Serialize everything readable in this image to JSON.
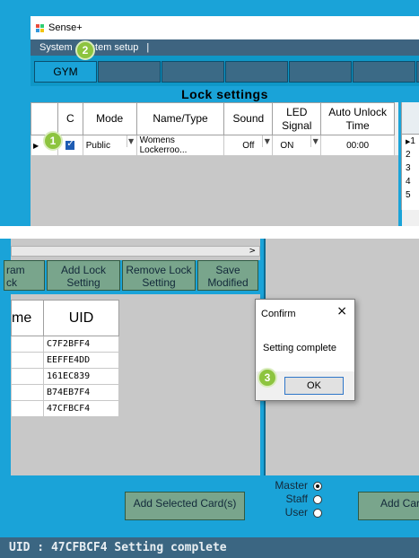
{
  "window": {
    "title": "Sense+"
  },
  "menu": {
    "items": [
      "System",
      "System setup"
    ]
  },
  "tabs": {
    "active": "GYM"
  },
  "lock_settings": {
    "title": "Lock settings",
    "columns": [
      "C",
      "Mode",
      "Name/Type",
      "Sound",
      "LED Signal",
      "Auto Unlock Time"
    ],
    "row": {
      "mode": "Public",
      "name": "Womens Lockerroo...",
      "sound": "Off",
      "led": "ON",
      "time": "00:00"
    }
  },
  "side_list": {
    "current": "1",
    "rows": [
      "2",
      "3",
      "4",
      "5"
    ]
  },
  "buttons": {
    "program_lock": "ram\nck",
    "add_lock": "Add Lock Setting",
    "remove_lock": "Remove Lock Setting",
    "save": "Save Modified"
  },
  "uid_table": {
    "name_header": "me",
    "uid_header": "UID",
    "uids": [
      "C7F2BFF4",
      "EEFFE4DD",
      "161EC839",
      "B74EB7F4",
      "47CFBCF4"
    ]
  },
  "dialog": {
    "title": "Confirm",
    "close": "×",
    "message": "Setting complete",
    "ok": "OK"
  },
  "cards": {
    "add_selected": "Add Selected Card(s)",
    "add_card": "Add Car",
    "roles": [
      {
        "label": "Master",
        "selected": true
      },
      {
        "label": "Staff",
        "selected": false
      },
      {
        "label": "User",
        "selected": false
      }
    ]
  },
  "status": {
    "text": "UID : 47CFBCF4 Setting complete"
  },
  "badges": [
    "1",
    "2",
    "3"
  ],
  "colors": {
    "accent": "#1aa3d8",
    "button_green": "#79a58c",
    "menu_bar": "#3e6480",
    "status_bar": "#3b6682",
    "badge": "#8dc43f"
  }
}
